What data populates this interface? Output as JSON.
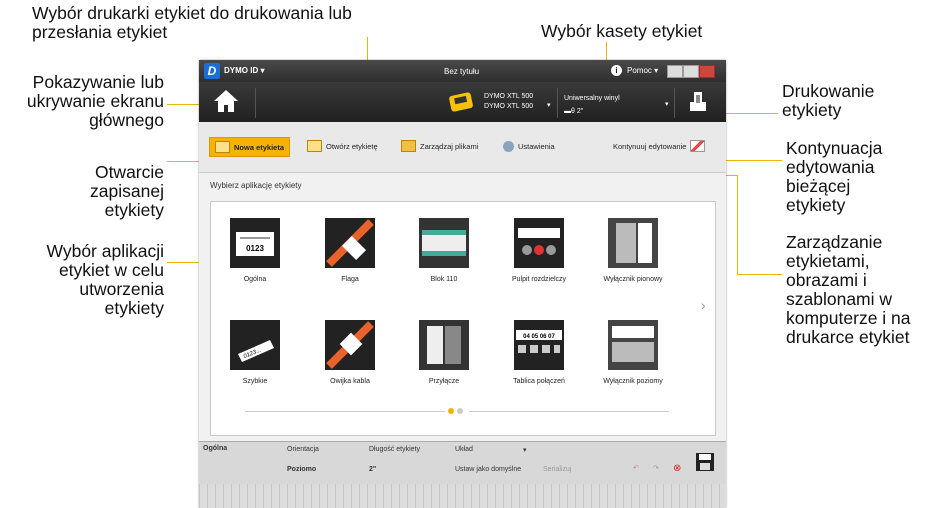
{
  "callouts": {
    "printer": "Wybór drukarki etykiet do drukowania lub przesłania etykiet",
    "cassette": "Wybór kasety etykiet",
    "home": "Pokazywanie lub ukrywanie ekranu głównego",
    "print": "Drukowanie etykiety",
    "continue": "Kontynuacja edytowania bieżącej etykiety",
    "open": "Otwarcie zapisanej etykiety",
    "manage": "Zarządzanie etykietami, obrazami i szablonami w komputerze i na drukarce etykiet",
    "select_app": "Wybór aplikacji etykiet w celu utworzenia etykiety"
  },
  "titlebar": {
    "logo": "D",
    "app": "DYMO ID ▾",
    "title": "Bez tytułu",
    "help_icon": "i",
    "help": "Pomoc ▾"
  },
  "toolbar": {
    "printer_line1": "DYMO XTL 500",
    "printer_line2": "DYMO XTL 500",
    "cassette_line1": "Uniwersalny winyl",
    "cassette_line2": "▬θ 2\""
  },
  "nav": {
    "new": "Nowa etykieta",
    "open": "Otwórz etykietę",
    "manage": "Zarządzaj plikami",
    "settings": "Ustawienia",
    "continue": "Kontynuuj edytowanie"
  },
  "main": {
    "select_title": "Wybierz aplikację etykiety",
    "tiles": [
      "Ogólna",
      "Flaga",
      "Blok 110",
      "Pulpit rozdzielczy",
      "Wyłącznik pionowy",
      "Szybkie",
      "Owijka kabla",
      "Przyłącze",
      "Tablica połączeń",
      "Wyłącznik poziomy"
    ],
    "tile_text": {
      "general": "0123",
      "quick": "0123...",
      "patch": "04 05 06 07"
    }
  },
  "props": {
    "section": "Ogólna",
    "orientation_label": "Orientacja",
    "orientation_value": "Poziomo",
    "length_label": "Długość etykiety",
    "length_value": "2\"",
    "layout_label": "Układ",
    "default_label": "Ustaw jako domyślne",
    "serial": "Serializuj"
  },
  "colors": {
    "accent": "#f0b400",
    "titlebar": "#2e2e2e"
  }
}
